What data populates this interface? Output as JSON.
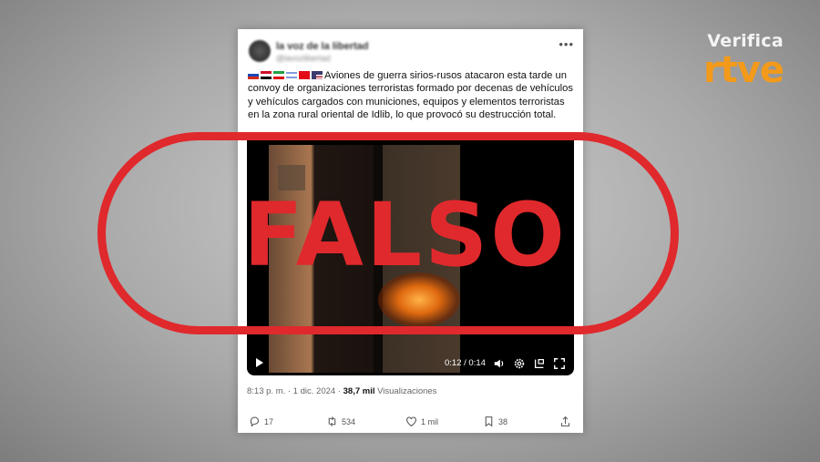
{
  "brand": {
    "line1": "Verifica",
    "line2": "rtve"
  },
  "post": {
    "username": "la voz de la libertad",
    "handle": "@lavozlibertad",
    "text": "Aviones de guerra sirios-rusos atacaron esta tarde un convoy de organizaciones terroristas formado por decenas de vehículos y vehículos cargados con municiones, equipos y elementos terroristas en la zona rural oriental de Idlib, lo que provocó su destrucción total.",
    "flags": [
      "russia-flag",
      "syria-flag",
      "iran-flag",
      "israel-flag",
      "turkey-flag",
      "usa-flag"
    ],
    "video_time": "0:12 / 0:14",
    "timestamp": "8:13 p. m. · 1 dic. 2024 ·",
    "views_count": "38,7 mil",
    "views_label": "Visualizaciones",
    "actions": {
      "replies": "17",
      "reposts": "534",
      "likes": "1 mil",
      "bookmarks": "38"
    }
  },
  "stamp": {
    "text": "FALSO",
    "color": "#e0292c"
  },
  "colors": {
    "brand_orange": "#f39a1a",
    "stamp_red": "#e0292c"
  }
}
